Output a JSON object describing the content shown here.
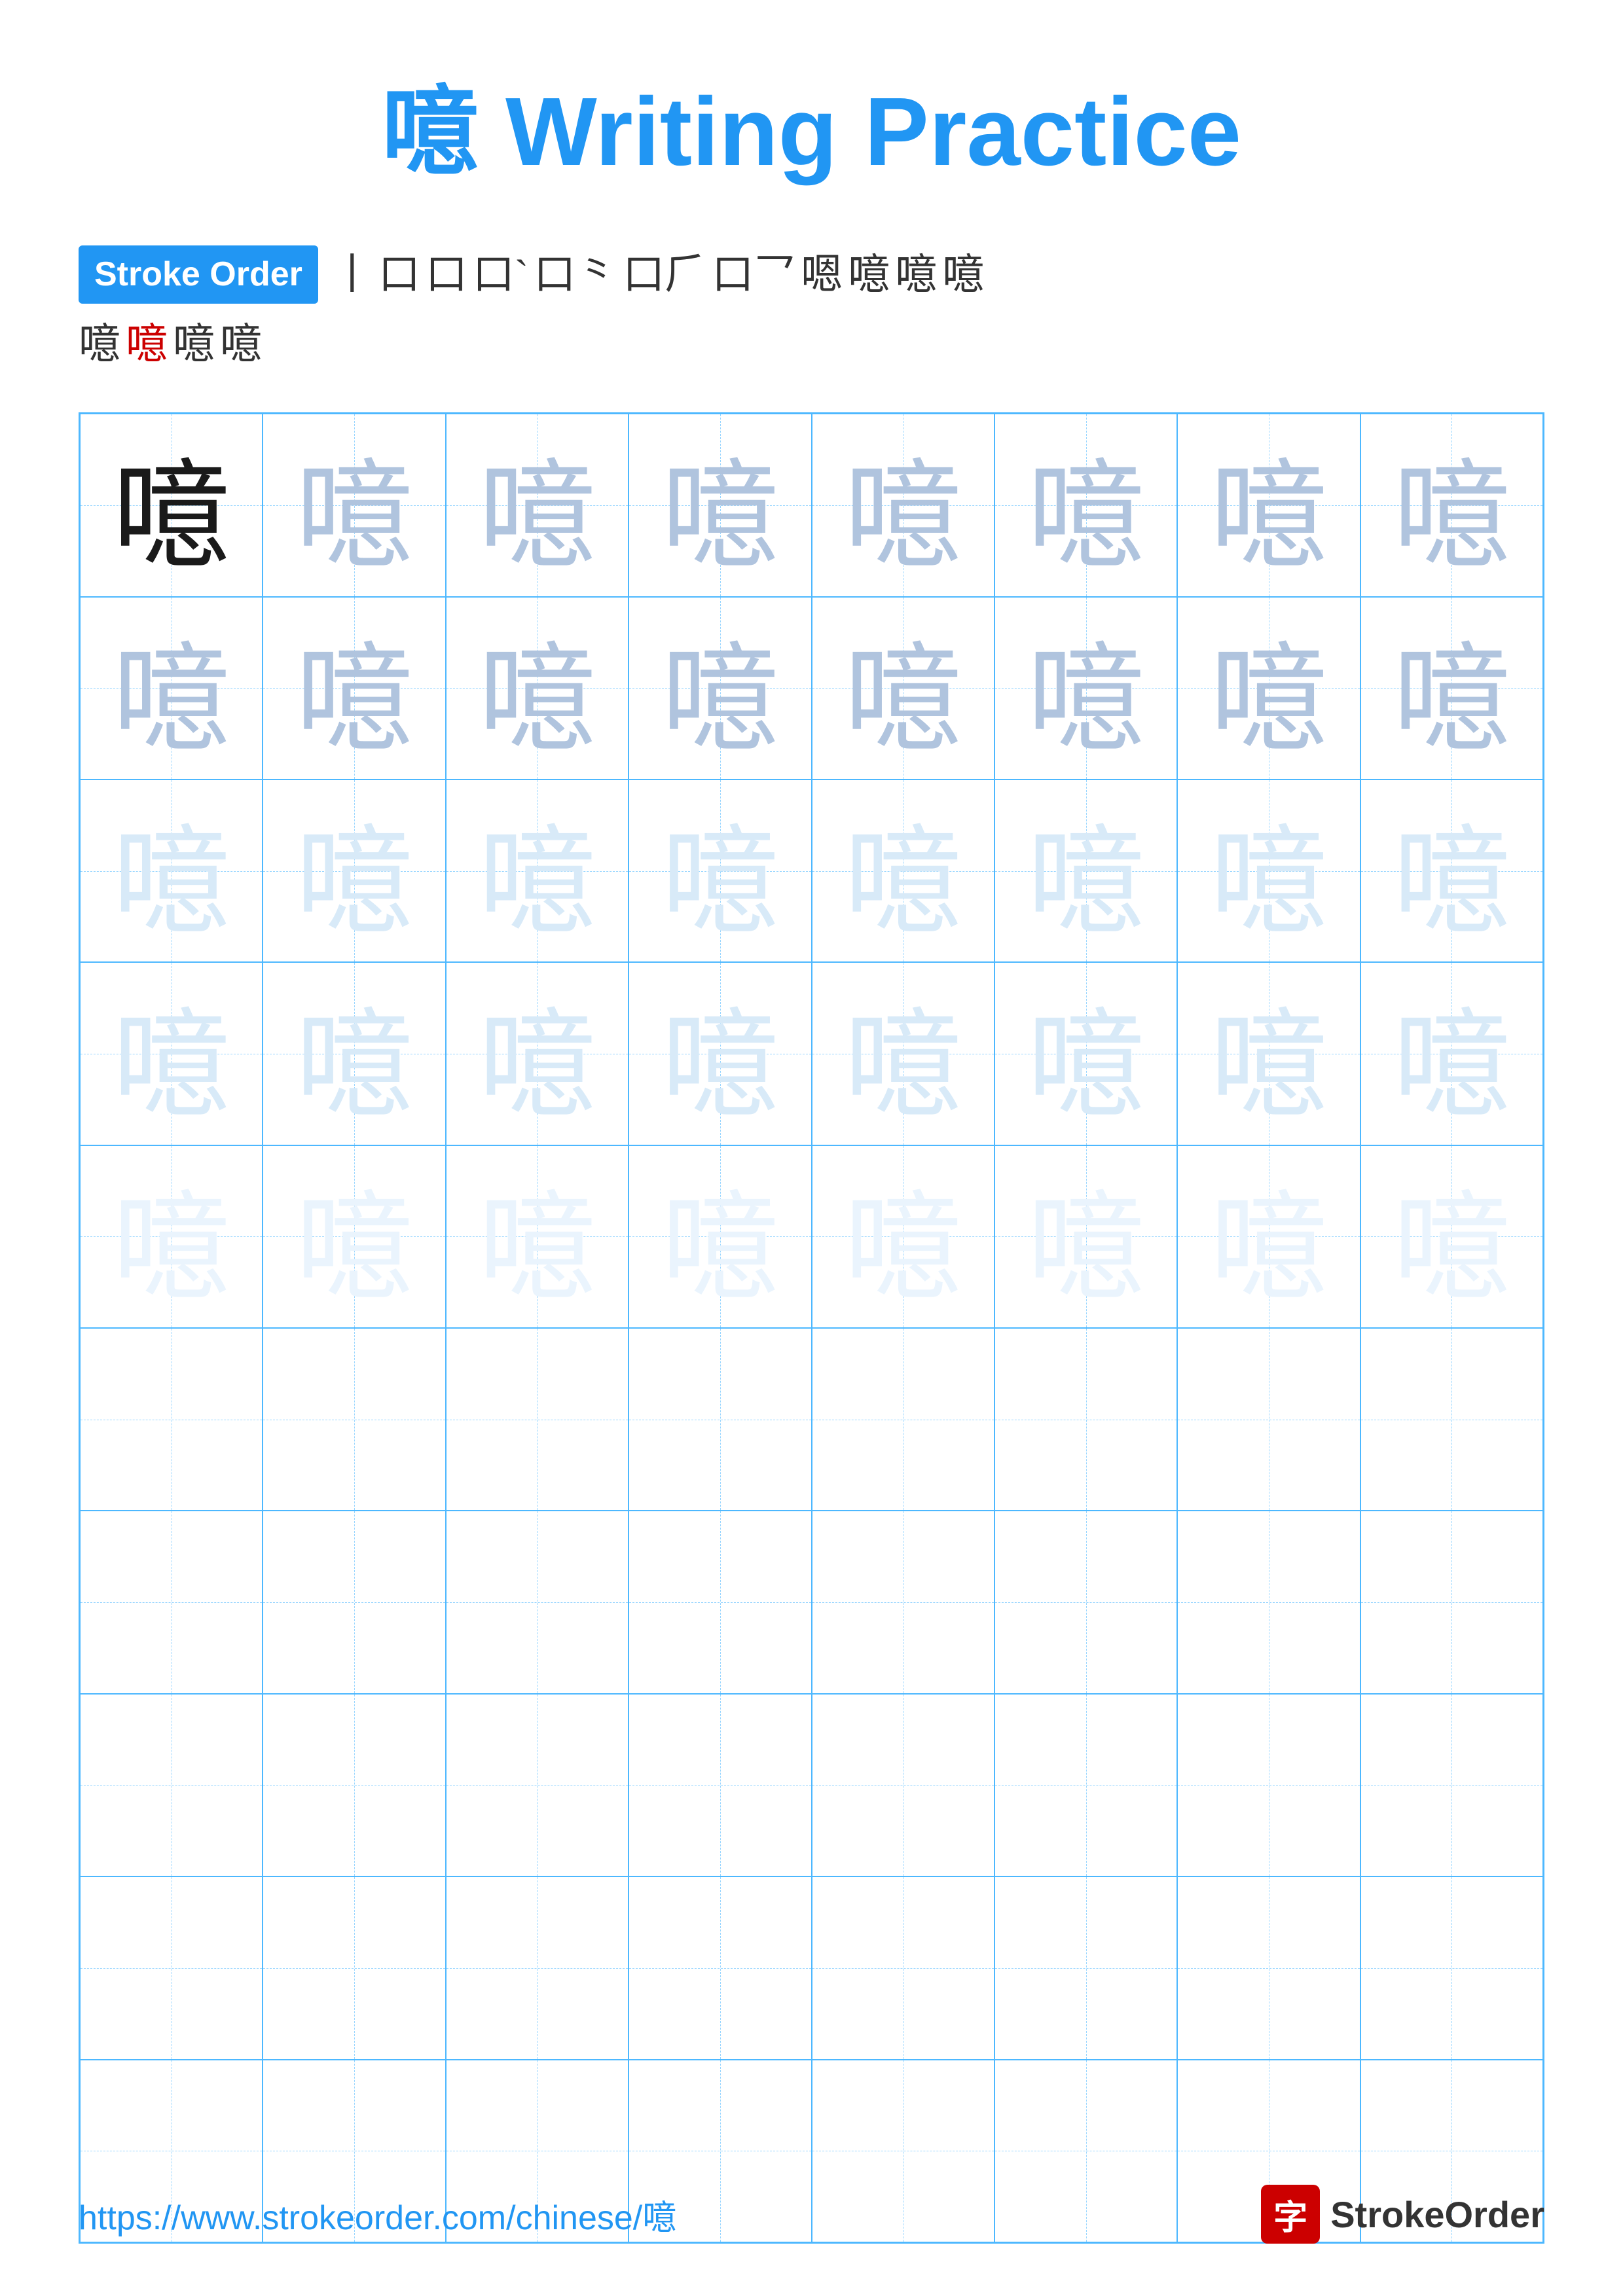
{
  "title": {
    "char": "噫",
    "label": "Writing Practice",
    "full": "噫 Writing Practice"
  },
  "stroke_order": {
    "badge_label": "Stroke Order",
    "sequence": [
      "丨",
      "口",
      "口",
      "口`",
      "口⺀",
      "口⺁",
      "口⺂",
      "口⺃",
      "嗯",
      "噫",
      "噫",
      "噫",
      "噫",
      "噫",
      "噫"
    ]
  },
  "grid": {
    "character": "噫",
    "rows": [
      [
        "dark",
        "medium",
        "medium",
        "medium",
        "medium",
        "medium",
        "medium",
        "medium"
      ],
      [
        "medium",
        "medium",
        "medium",
        "medium",
        "medium",
        "medium",
        "medium",
        "medium"
      ],
      [
        "light",
        "light",
        "light",
        "light",
        "light",
        "light",
        "light",
        "light"
      ],
      [
        "light",
        "light",
        "light",
        "light",
        "light",
        "light",
        "light",
        "light"
      ],
      [
        "very-light",
        "very-light",
        "very-light",
        "very-light",
        "very-light",
        "very-light",
        "very-light",
        "very-light"
      ],
      [
        "empty",
        "empty",
        "empty",
        "empty",
        "empty",
        "empty",
        "empty",
        "empty"
      ],
      [
        "empty",
        "empty",
        "empty",
        "empty",
        "empty",
        "empty",
        "empty",
        "empty"
      ],
      [
        "empty",
        "empty",
        "empty",
        "empty",
        "empty",
        "empty",
        "empty",
        "empty"
      ],
      [
        "empty",
        "empty",
        "empty",
        "empty",
        "empty",
        "empty",
        "empty",
        "empty"
      ],
      [
        "empty",
        "empty",
        "empty",
        "empty",
        "empty",
        "empty",
        "empty",
        "empty"
      ]
    ]
  },
  "footer": {
    "url": "https://www.strokeorder.com/chinese/噫",
    "brand_char": "字",
    "brand_name": "StrokeOrder"
  }
}
